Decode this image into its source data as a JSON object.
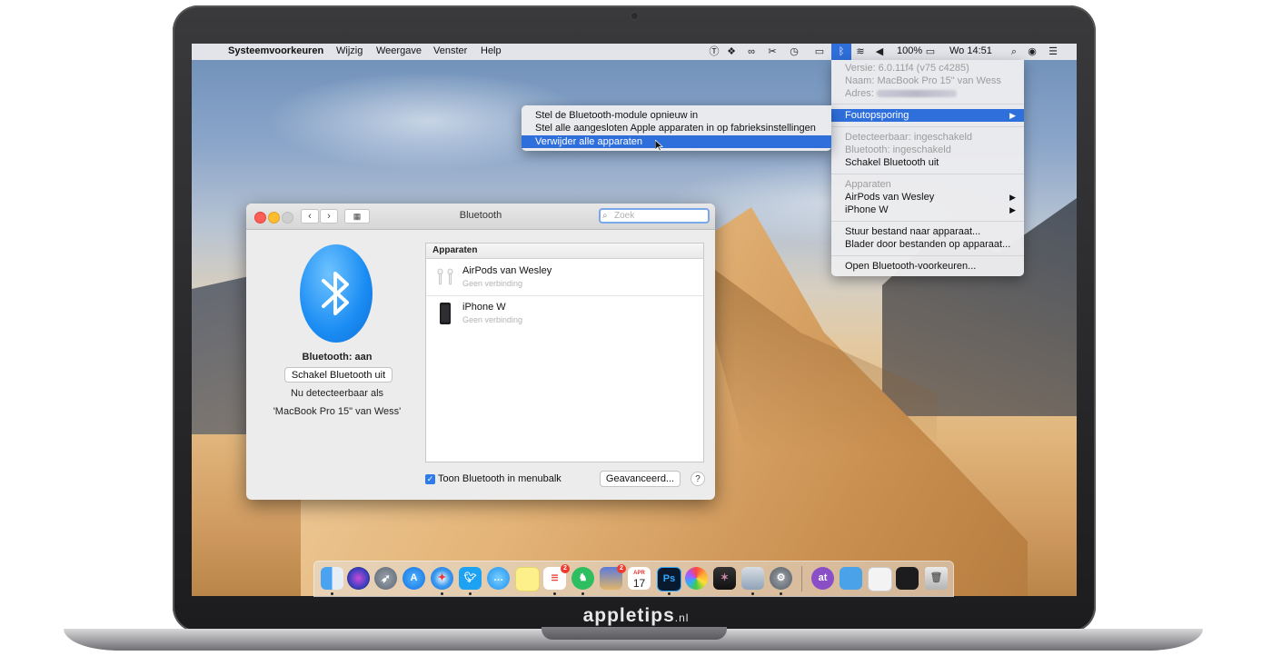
{
  "menubar": {
    "apple": "",
    "app": "Systeemvoorkeuren",
    "menus": [
      "Wijzig",
      "Weergave",
      "Venster",
      "Help"
    ],
    "battery": "100%",
    "clock": "Wo 14:51",
    "status_icons": [
      "tilde-icon",
      "dropbox-icon",
      "creative-cloud-icon",
      "scissors-icon",
      "time-machine-icon",
      "airplay-icon",
      "bluetooth-icon",
      "wifi-icon",
      "volume-icon",
      "battery-icon",
      "spotlight-icon",
      "siri-icon",
      "notification-center-icon"
    ]
  },
  "bt_menu": {
    "version": "Versie: 6.0.11f4 (v75 c4285)",
    "name": "Naam: MacBook Pro 15\" van Wess",
    "address": "Adres:",
    "troubleshoot": "Foutopsporing",
    "discoverable": "Detecteerbaar: ingeschakeld",
    "bt_enabled": "Bluetooth: ingeschakeld",
    "turn_off": "Schakel Bluetooth uit",
    "devices_header": "Apparaten",
    "device1": "AirPods van Wesley",
    "device2": "iPhone W",
    "send_file": "Stuur bestand naar apparaat...",
    "browse_files": "Blader door bestanden op apparaat...",
    "open_prefs": "Open Bluetooth-voorkeuren..."
  },
  "submenu": {
    "reset_module": "Stel de Bluetooth-module opnieuw in",
    "factory_reset": "Stel alle aangesloten Apple apparaten in op fabrieksinstellingen",
    "remove_all": "Verwijder alle apparaten"
  },
  "window": {
    "title": "Bluetooth",
    "search_placeholder": "Zoek",
    "status": "Bluetooth: aan",
    "toggle_button": "Schakel Bluetooth uit",
    "discoverable_line1": "Nu detecteerbaar als",
    "discoverable_line2": "'MacBook Pro 15\" van Wess'",
    "devices_header": "Apparaten",
    "devices": [
      {
        "name": "AirPods van Wesley",
        "status": "Geen verbinding"
      },
      {
        "name": "iPhone W",
        "status": "Geen verbinding"
      }
    ],
    "show_in_menubar": "Toon Bluetooth in menubalk",
    "advanced_button": "Geavanceerd...",
    "help_button": "?"
  },
  "dock": {
    "calendar_month": "APR",
    "calendar_day": "17",
    "reminders_badge": "2",
    "photos_badge": "2",
    "ps_label": "Ps",
    "at_label": "at"
  },
  "brand": {
    "name": "appletips",
    "tld": ".nl"
  },
  "colors": {
    "accent": "#2f6fdc",
    "bluetooth_icon": "#1a8cf3"
  }
}
